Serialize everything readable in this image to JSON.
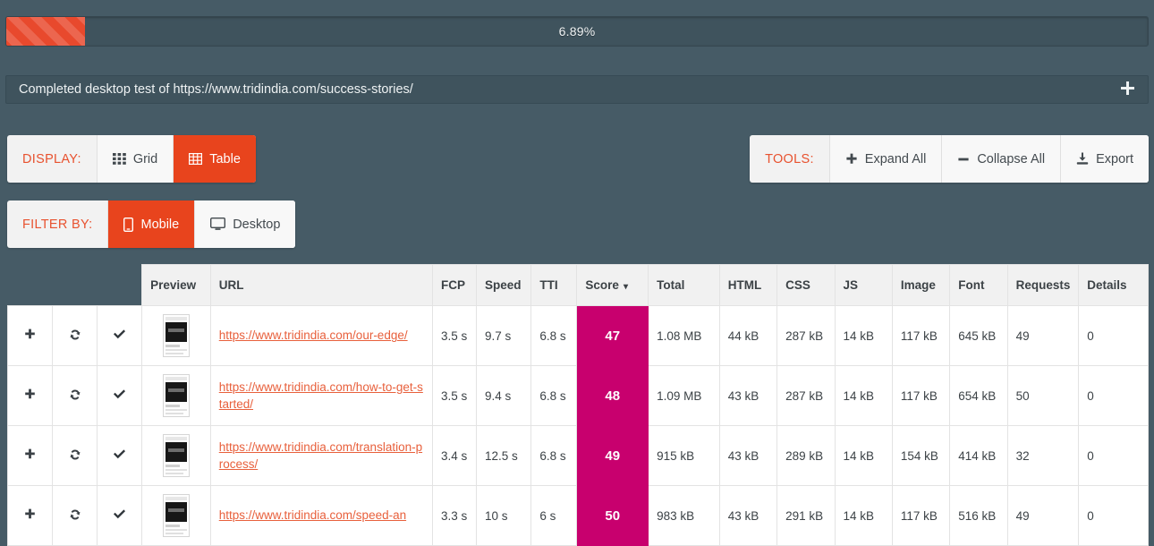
{
  "progress": {
    "percent_label": "6.89%",
    "percent_value": 6.89,
    "bar_color": "#e8492d"
  },
  "status": {
    "message": "Completed desktop test of https://www.tridindia.com/success-stories/",
    "expand_icon": "plus-icon"
  },
  "display_group": {
    "label": "DISPLAY:",
    "buttons": [
      {
        "label": "Grid",
        "icon": "grid-icon",
        "active": false
      },
      {
        "label": "Table",
        "icon": "table-icon",
        "active": true
      }
    ]
  },
  "filter_group": {
    "label": "FILTER BY:",
    "buttons": [
      {
        "label": "Mobile",
        "icon": "mobile-icon",
        "active": true
      },
      {
        "label": "Desktop",
        "icon": "desktop-icon",
        "active": false
      }
    ]
  },
  "tools_group": {
    "label": "TOOLS:",
    "buttons": [
      {
        "label": "Expand All",
        "icon": "plus-icon"
      },
      {
        "label": "Collapse All",
        "icon": "minus-icon"
      },
      {
        "label": "Export",
        "icon": "download-icon"
      }
    ]
  },
  "table": {
    "sorted_column": "Score",
    "sort_direction": "desc",
    "row_actions": [
      "plus-icon",
      "refresh-icon",
      "check-icon"
    ],
    "columns": [
      "Preview",
      "URL",
      "FCP",
      "Speed",
      "TTI",
      "Score",
      "Total",
      "HTML",
      "CSS",
      "JS",
      "Image",
      "Font",
      "Requests",
      "Details"
    ],
    "rows": [
      {
        "url": "https://www.tridindia.com/our-edge/",
        "fcp": "3.5 s",
        "speed": "9.7 s",
        "tti": "6.8 s",
        "score": "47",
        "total": "1.08 MB",
        "html": "44 kB",
        "css": "287 kB",
        "js": "14 kB",
        "image": "117 kB",
        "font": "645 kB",
        "requests": "49",
        "details": "0"
      },
      {
        "url": "https://www.tridindia.com/how-to-get-started/",
        "fcp": "3.5 s",
        "speed": "9.4 s",
        "tti": "6.8 s",
        "score": "48",
        "total": "1.09 MB",
        "html": "43 kB",
        "css": "287 kB",
        "js": "14 kB",
        "image": "117 kB",
        "font": "654 kB",
        "requests": "50",
        "details": "0"
      },
      {
        "url": "https://www.tridindia.com/translation-process/",
        "fcp": "3.4 s",
        "speed": "12.5 s",
        "tti": "6.8 s",
        "score": "49",
        "total": "915 kB",
        "html": "43 kB",
        "css": "289 kB",
        "js": "14 kB",
        "image": "154 kB",
        "font": "414 kB",
        "requests": "32",
        "details": "0"
      },
      {
        "url": "https://www.tridindia.com/speed-an",
        "fcp": "3.3 s",
        "speed": "10 s",
        "tti": "6 s",
        "score": "50",
        "total": "983 kB",
        "html": "43 kB",
        "css": "291 kB",
        "js": "14 kB",
        "image": "117 kB",
        "font": "516 kB",
        "requests": "49",
        "details": "0"
      }
    ]
  }
}
